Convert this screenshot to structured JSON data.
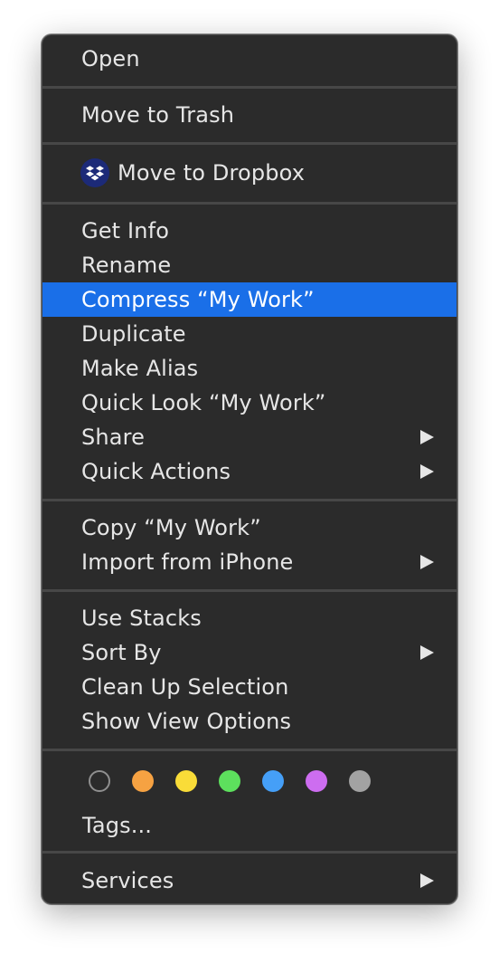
{
  "menu": {
    "open": "Open",
    "move_to_trash": "Move to Trash",
    "move_to_dropbox": "Move to Dropbox",
    "get_info": "Get Info",
    "rename": "Rename",
    "compress": "Compress “My Work”",
    "duplicate": "Duplicate",
    "make_alias": "Make Alias",
    "quick_look": "Quick Look “My Work”",
    "share": "Share",
    "quick_actions": "Quick Actions",
    "copy": "Copy “My Work”",
    "import_from_iphone": "Import from iPhone",
    "use_stacks": "Use Stacks",
    "sort_by": "Sort By",
    "clean_up_selection": "Clean Up Selection",
    "show_view_options": "Show View Options",
    "tags": "Tags...",
    "services": "Services"
  },
  "highlighted_item": "compress",
  "tag_colors": {
    "none": "#2b2b2b",
    "orange": "#f6a242",
    "yellow": "#f9dc38",
    "green": "#5de05d",
    "blue": "#459ff7",
    "purple": "#cd6df0",
    "gray": "#a2a2a2"
  },
  "accent": "#1a6fe8",
  "icons": {
    "dropbox": "dropbox-icon",
    "submenu": "submenu-arrow-icon"
  }
}
